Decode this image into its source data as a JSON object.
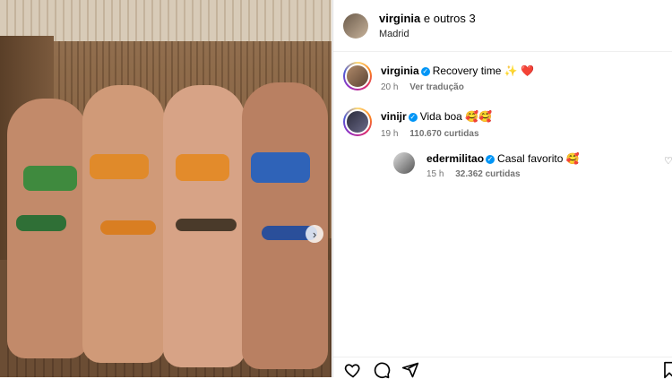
{
  "post": {
    "next_icon": "chevron-right-icon"
  },
  "header": {
    "username": "virginia",
    "conjunction": "e outros 3",
    "location": "Madrid"
  },
  "comments": [
    {
      "username": "virginia",
      "verified": true,
      "text": "Recovery time ✨ ❤️",
      "time": "20 h",
      "action": "Ver tradução"
    },
    {
      "username": "vinijr",
      "verified": true,
      "text": "Vida boa 🥰🥰",
      "time": "19 h",
      "likes": "110.670 curtidas"
    }
  ],
  "reply": {
    "username": "edermilitao",
    "verified": true,
    "text": "Casal favorito 🥰",
    "time": "15 h",
    "likes": "32.362 curtidas"
  },
  "actions": {
    "like_icon": "heart-icon",
    "comment_icon": "comment-icon",
    "share_icon": "send-icon",
    "save_icon": "bookmark-icon"
  },
  "colors": {
    "verified": "#0095f6",
    "muted_text": "#737373"
  }
}
